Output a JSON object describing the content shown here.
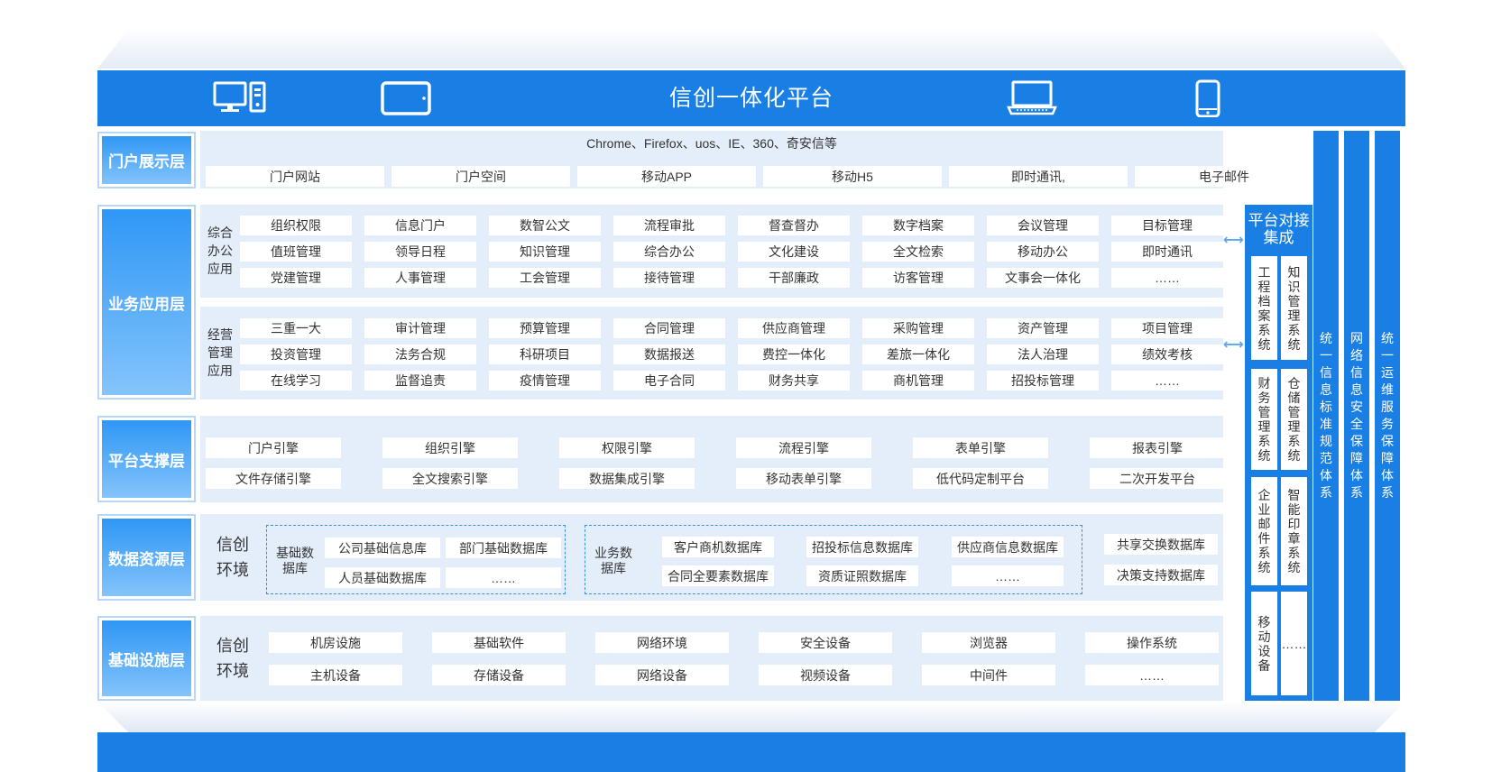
{
  "platform_title": "信创一体化平台",
  "header_icons": [
    "desktop-icon",
    "tablet-icon",
    "laptop-icon",
    "phone-icon"
  ],
  "layers": {
    "portal": "门户展示层",
    "business": "业务应用层",
    "support": "平台支撑层",
    "data": "数据资源层",
    "infra": "基础设施层"
  },
  "portal": {
    "browsers": "Chrome、Firefox、uos、IE、360、奇安信等",
    "items": [
      "门户网站",
      "门户空间",
      "移动APP",
      "移动H5",
      "即时通讯,",
      "电子邮件"
    ]
  },
  "business": {
    "office": {
      "label": "综合办公应用",
      "rows": [
        [
          "组织权限",
          "信息门户",
          "数智公文",
          "流程审批",
          "督查督办",
          "数字档案",
          "会议管理",
          "目标管理"
        ],
        [
          "值班管理",
          "领导日程",
          "知识管理",
          "综合办公",
          "文化建设",
          "全文检索",
          "移动办公",
          "即时通讯"
        ],
        [
          "党建管理",
          "人事管理",
          "工会管理",
          "接待管理",
          "干部廉政",
          "访客管理",
          "文事会一体化",
          "……"
        ]
      ]
    },
    "operation": {
      "label": "经营管理应用",
      "rows": [
        [
          "三重一大",
          "审计管理",
          "预算管理",
          "合同管理",
          "供应商管理",
          "采购管理",
          "资产管理",
          "项目管理"
        ],
        [
          "投资管理",
          "法务合规",
          "科研项目",
          "数据报送",
          "费控一体化",
          "差旅一体化",
          "法人治理",
          "绩效考核"
        ],
        [
          "在线学习",
          "监督追责",
          "疫情管理",
          "电子合同",
          "财务共享",
          "商机管理",
          "招投标管理",
          "……"
        ]
      ]
    }
  },
  "support": {
    "rows": [
      [
        "门户引擎",
        "组织引擎",
        "权限引擎",
        "流程引擎",
        "表单引擎",
        "报表引擎"
      ],
      [
        "文件存储引擎",
        "全文搜索引擎",
        "数据集成引擎",
        "移动表单引擎",
        "低代码定制平台",
        "二次开发平台"
      ]
    ]
  },
  "data": {
    "xc_label": "信创环境",
    "basic_label": "基础数据库",
    "basic_items": [
      "公司基础信息库",
      "部门基础数据库",
      "人员基础数据库",
      "……"
    ],
    "biz_label": "业务数据库",
    "biz_items": [
      "客户商机数据库",
      "招投标信息数据库",
      "供应商信息数据库",
      "合同全要素数据库",
      "资质证照数据库",
      "……"
    ],
    "extra_items": [
      "共享交换数据库",
      "决策支持数据库"
    ]
  },
  "infra": {
    "xc_label": "信创环境",
    "rows": [
      [
        "机房设施",
        "基础软件",
        "网络环境",
        "安全设备",
        "浏览器",
        "操作系统"
      ],
      [
        "主机设备",
        "存储设备",
        "网络设备",
        "视频设备",
        "中间件",
        "……"
      ]
    ]
  },
  "integration": {
    "title": "平台对接集成",
    "items": [
      "工程档案系统",
      "知识管理系统",
      "财务管理系统",
      "仓储管理系统",
      "企业邮件系统",
      "智能印章系统",
      "移动设备",
      "……"
    ]
  },
  "side_bars": [
    "统一信息标准规范体系",
    "网络信息安全保障体系",
    "统一运维服务保障体系"
  ],
  "colors": {
    "primary": "#1a7fe4",
    "panel": "#e4eefa",
    "label_gradient_top": "#2f97f5",
    "label_gradient_bottom": "#84c4fb"
  }
}
